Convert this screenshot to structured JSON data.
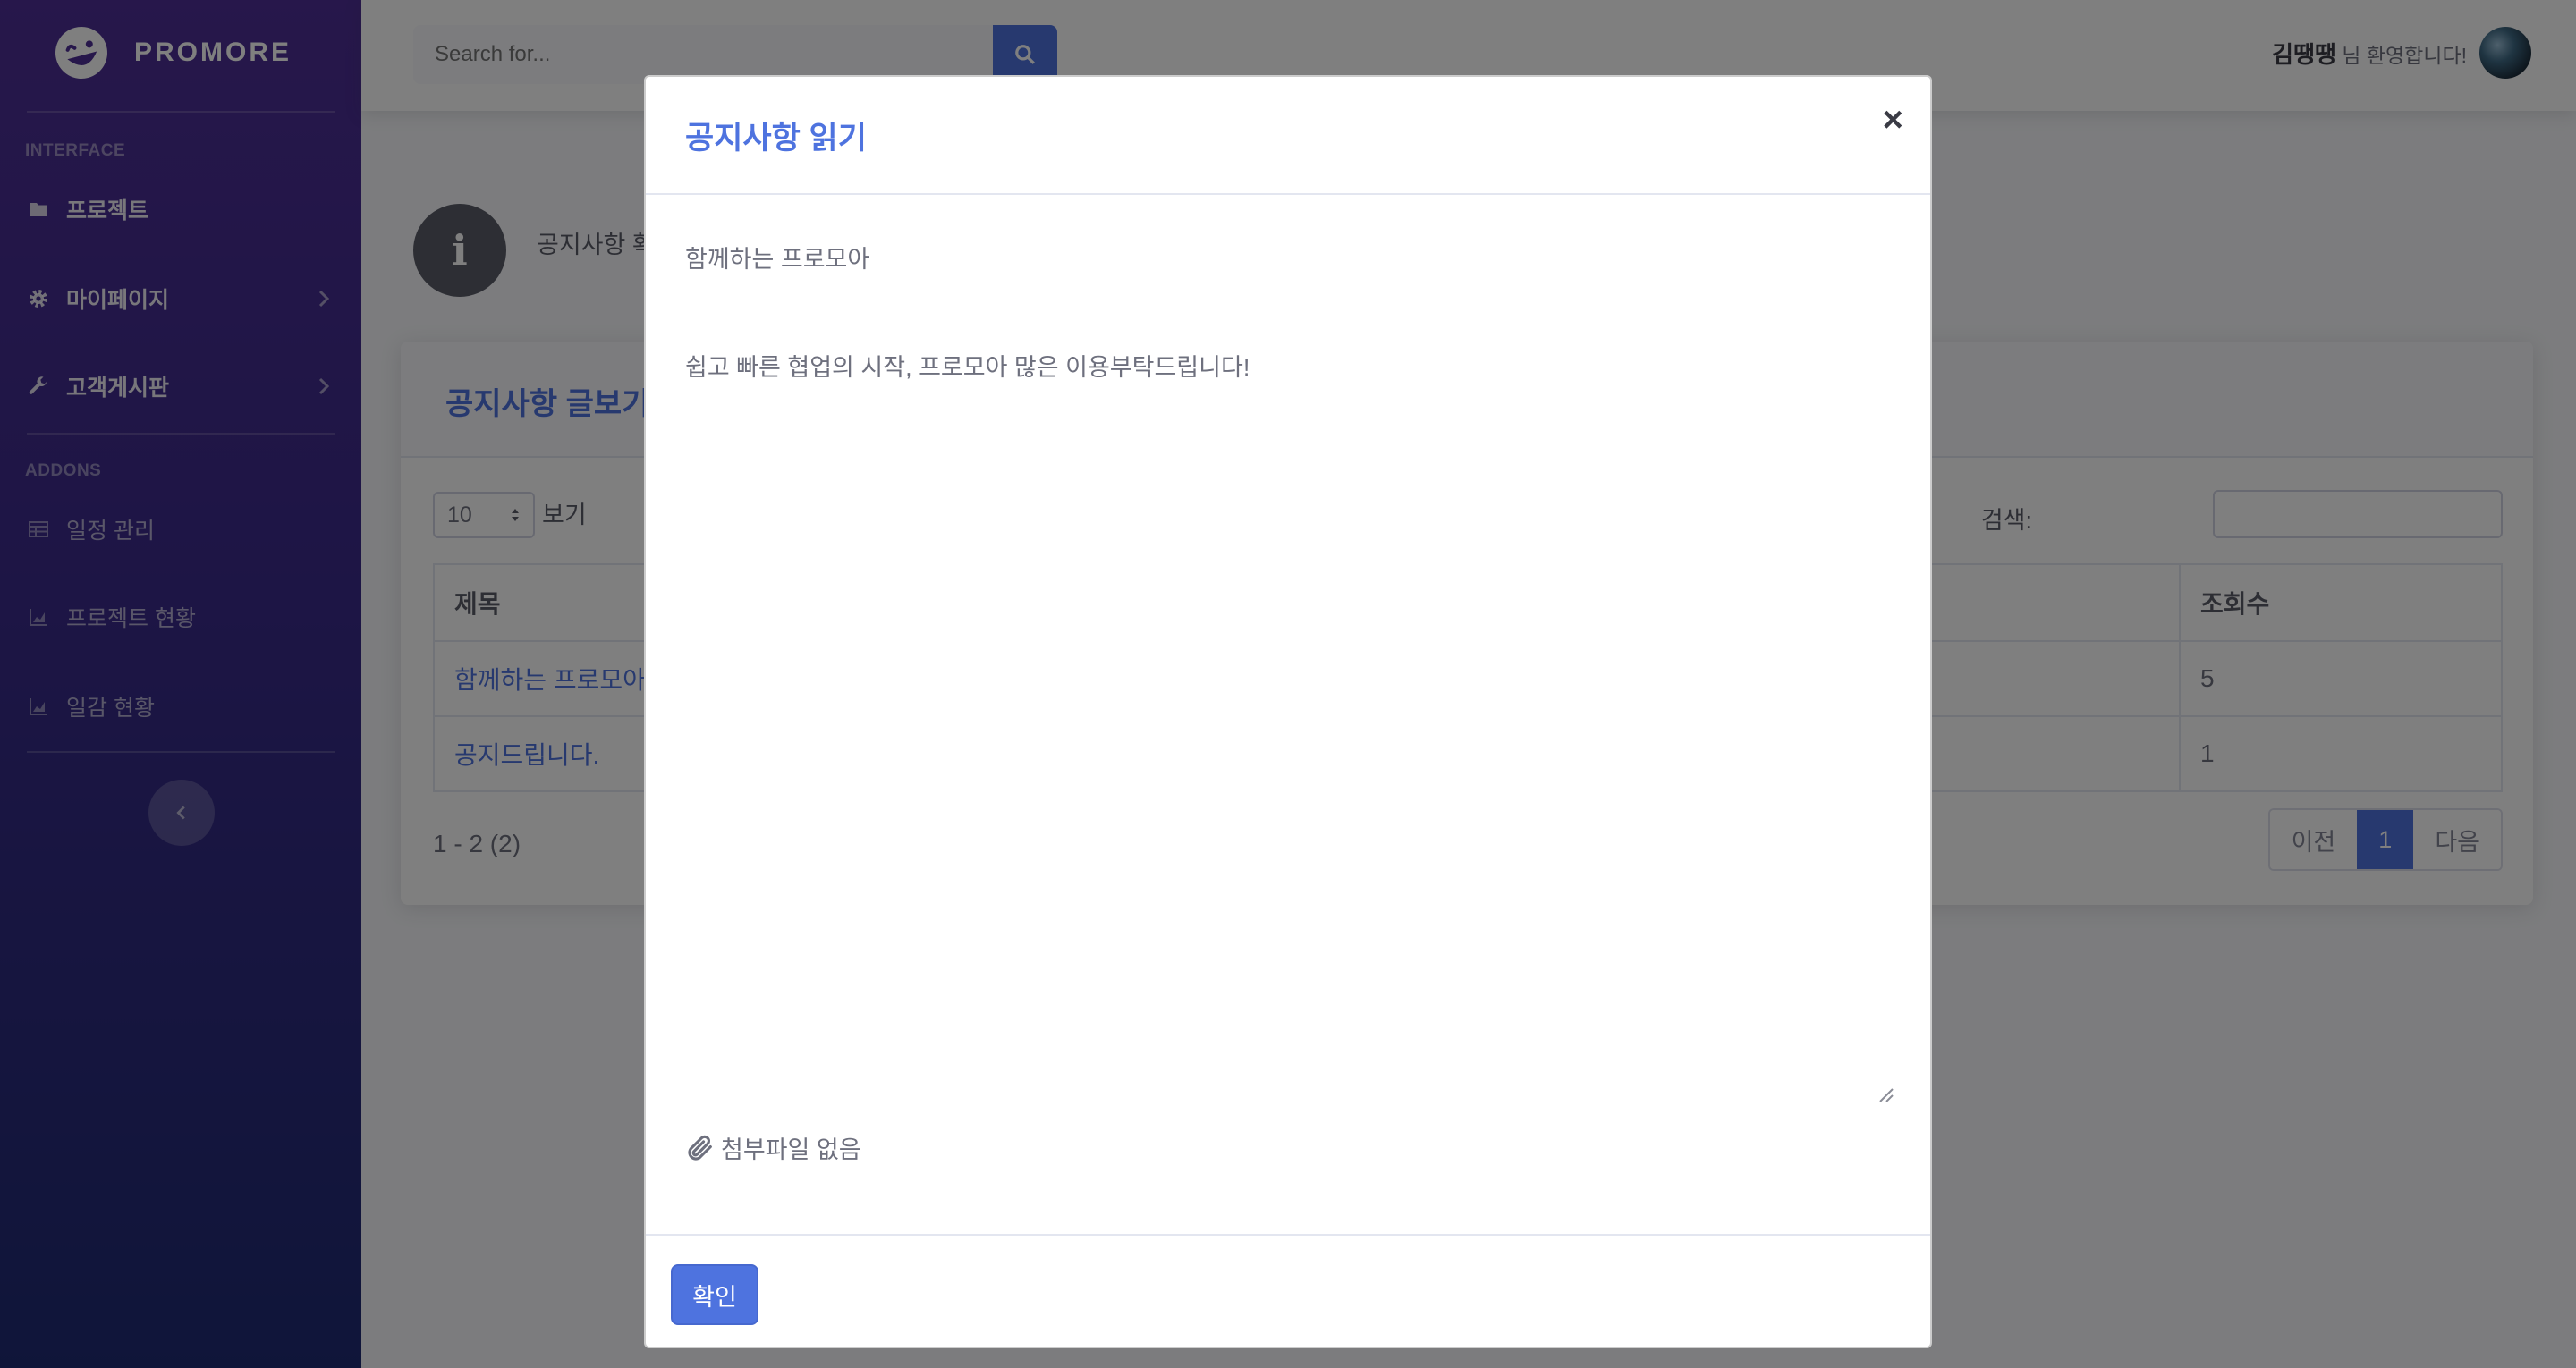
{
  "brand": {
    "name": "PROMORE",
    "logo_icon": "laugh-wink-icon"
  },
  "sidebar": {
    "heading_interface": "INTERFACE",
    "heading_addons": "ADDONS",
    "items": [
      {
        "label": "프로젝트",
        "icon": "folder-icon"
      },
      {
        "label": "마이페이지",
        "icon": "gear-icon",
        "has_submenu": true
      },
      {
        "label": "고객게시판",
        "icon": "wrench-icon",
        "has_submenu": true
      },
      {
        "label": "일정 관리",
        "icon": "table-icon"
      },
      {
        "label": "프로젝트 현황",
        "icon": "area-chart-icon"
      },
      {
        "label": "일감 현황",
        "icon": "area-chart-icon"
      }
    ]
  },
  "topbar": {
    "search_placeholder": "Search for...",
    "user_name": "김땡땡",
    "user_greeting": "님 환영합니다!"
  },
  "page": {
    "notice_text": "공지사항 확",
    "card_title": "공지사항 글보기",
    "length_value": "10",
    "length_label": "보기",
    "search_label": "검색:",
    "columns": {
      "title": "제목",
      "views": "조회수"
    },
    "rows": [
      {
        "title": "함께하는 프로모아",
        "views": "5"
      },
      {
        "title": "공지드립니다.",
        "views": "1"
      }
    ],
    "count_text": "1 - 2 (2)",
    "pager": {
      "prev": "이전",
      "current": "1",
      "next": "다음"
    }
  },
  "modal": {
    "title": "공지사항 읽기",
    "close_label": "×",
    "subject": "함께하는 프로모아",
    "content": "쉽고 빠른 협업의 시작, 프로모아 많은 이용부탁드립니다!",
    "attachment_text": "첨부파일 없음",
    "ok_label": "확인"
  },
  "colors": {
    "primary": "#4e73df",
    "sidebar_top": "#4e2f96",
    "sidebar_bottom": "#1f2b73",
    "overlay": "rgba(0,0,0,0.5)"
  }
}
